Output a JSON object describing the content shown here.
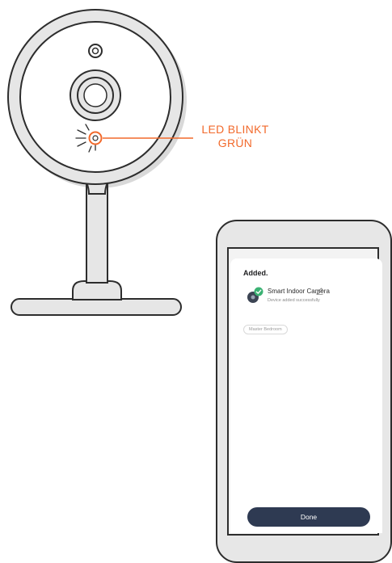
{
  "callout": {
    "line1": "LED BLINKT",
    "line2": "GRÜN"
  },
  "phone_screen": {
    "heading": "Added.",
    "device": {
      "name": "Smart Indoor Camera",
      "status": "Device added successfully"
    },
    "room": "Master Bedroom",
    "done_label": "Done"
  },
  "colors": {
    "accent_orange": "#f26a2c",
    "button_navy": "#2e3a52",
    "success_green": "#3bb273",
    "outline": "#2d2d2d",
    "device_fill": "#e6e6e6"
  },
  "icons": [
    "camera-illustration",
    "led-indicator-icon",
    "camera-device-icon",
    "success-check-icon",
    "edit-pencil-icon"
  ]
}
